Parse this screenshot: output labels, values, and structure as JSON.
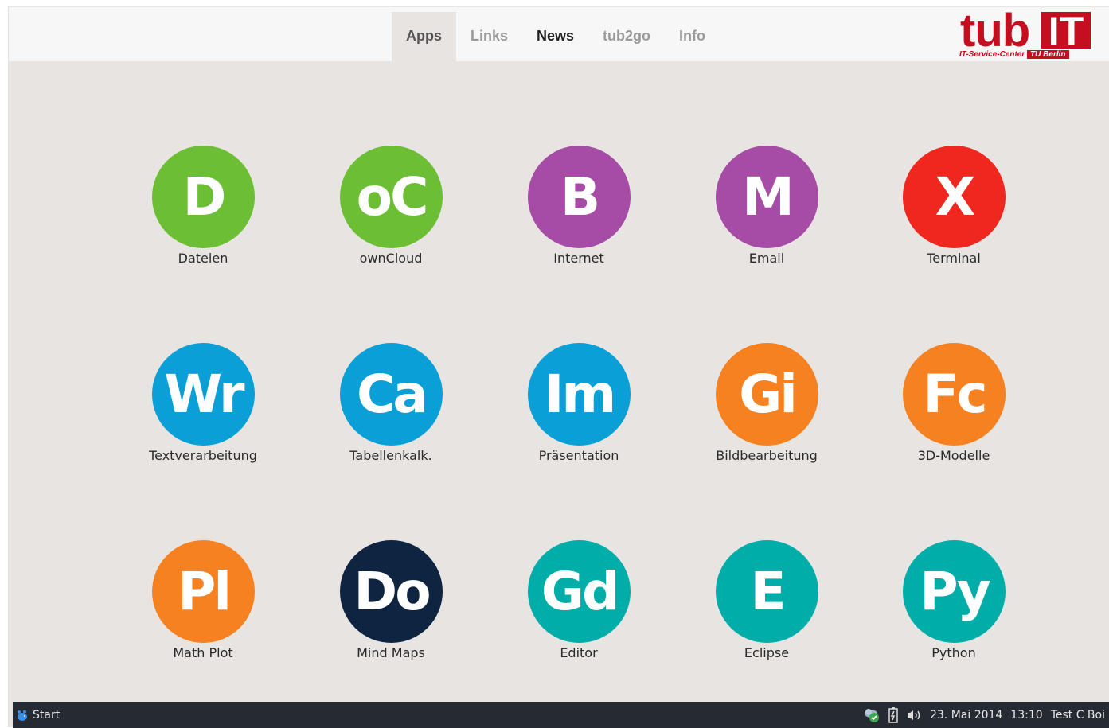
{
  "nav": {
    "items": [
      {
        "label": "Apps",
        "state": "active"
      },
      {
        "label": "Links",
        "state": "normal"
      },
      {
        "label": "News",
        "state": "bold"
      },
      {
        "label": "tub2go",
        "state": "normal"
      },
      {
        "label": "Info",
        "state": "normal"
      }
    ]
  },
  "logo": {
    "wordmark": "tub",
    "wordmark_box": "IT",
    "subtitle": "IT-Service-Center",
    "subtitle_box": "TU Berlin"
  },
  "apps": [
    {
      "abbr": "D",
      "label": "Dateien",
      "color": "#6cbf35"
    },
    {
      "abbr": "oC",
      "label": "ownCloud",
      "color": "#6cbf35"
    },
    {
      "abbr": "B",
      "label": "Internet",
      "color": "#a64ca6"
    },
    {
      "abbr": "M",
      "label": "Email",
      "color": "#a64ca6"
    },
    {
      "abbr": "X",
      "label": "Terminal",
      "color": "#f0271f"
    },
    {
      "abbr": "Wr",
      "label": "Textverarbeitung",
      "color": "#0a9fd6"
    },
    {
      "abbr": "Ca",
      "label": "Tabellenkalk.",
      "color": "#0a9fd6"
    },
    {
      "abbr": "Im",
      "label": "Präsentation",
      "color": "#0a9fd6"
    },
    {
      "abbr": "Gi",
      "label": "Bildbearbeitung",
      "color": "#f68121"
    },
    {
      "abbr": "Fc",
      "label": "3D-Modelle",
      "color": "#f68121"
    },
    {
      "abbr": "Pl",
      "label": "Math Plot",
      "color": "#f68121"
    },
    {
      "abbr": "Do",
      "label": "Mind Maps",
      "color": "#0f2440"
    },
    {
      "abbr": "Gd",
      "label": "Editor",
      "color": "#00ada8"
    },
    {
      "abbr": "E",
      "label": "Eclipse",
      "color": "#00ada8"
    },
    {
      "abbr": "Py",
      "label": "Python",
      "color": "#00ada8"
    }
  ],
  "taskbar": {
    "start_label": "Start",
    "tray_icons": [
      "cloud-sync-icon",
      "battery-icon",
      "volume-icon"
    ],
    "date": "23. Mai 2014",
    "time": "13:10",
    "user": "Test C Boi"
  }
}
